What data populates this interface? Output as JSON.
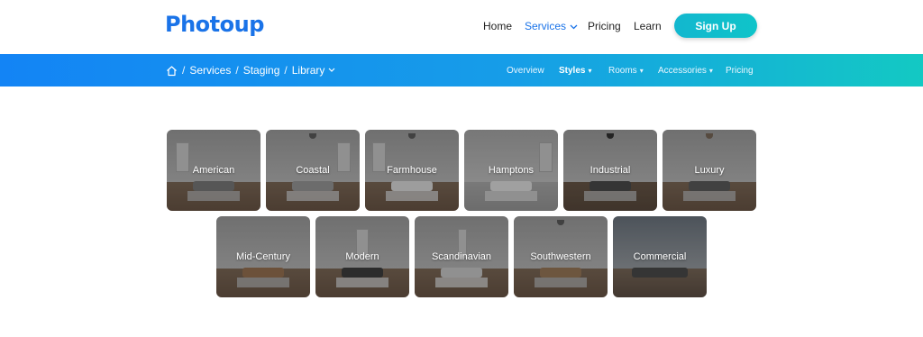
{
  "header": {
    "logo": "Photoup",
    "nav": {
      "home": "Home",
      "services": "Services",
      "pricing": "Pricing",
      "learn": "Learn"
    },
    "signup": "Sign Up"
  },
  "band": {
    "breadcrumb": {
      "services": "Services",
      "staging": "Staging",
      "library": "Library",
      "separator": "/"
    },
    "subnav": {
      "overview": "Overview",
      "styles": "Styles",
      "rooms": "Rooms",
      "accessories": "Accessories",
      "pricing": "Pricing"
    }
  },
  "styles": {
    "row1": [
      "American",
      "Coastal",
      "Farmhouse",
      "Hamptons",
      "Industrial",
      "Luxury"
    ],
    "row2": [
      "Mid-Century",
      "Modern",
      "Scandinavian",
      "Southwestern",
      "Commercial"
    ]
  },
  "colors": {
    "brand_blue": "#1a73e8",
    "signup_teal": "#12b7cf",
    "band_start": "#1384f5",
    "band_end": "#13c9c3"
  },
  "icons": {
    "home": "home-icon",
    "chevron": "chevron-down-icon"
  }
}
